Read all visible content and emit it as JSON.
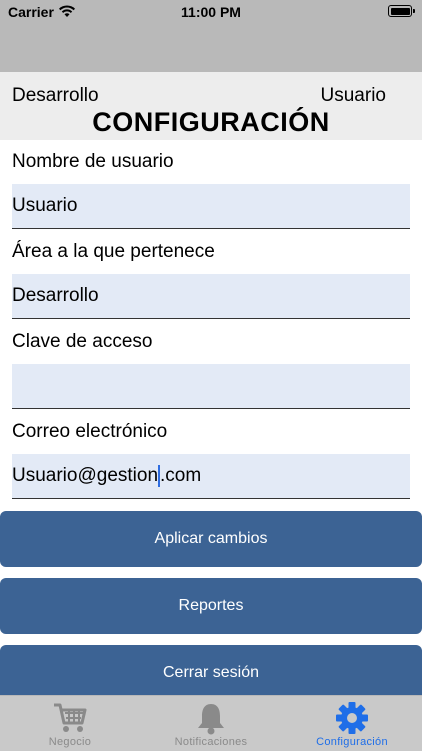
{
  "status_bar": {
    "carrier": "Carrier",
    "time": "11:00 PM"
  },
  "header": {
    "area": "Desarrollo",
    "user": "Usuario",
    "title": "CONFIGURACIÓN"
  },
  "form": {
    "username_label": "Nombre de usuario",
    "username_value": "Usuario",
    "area_label": "Área a la que pertenece",
    "area_value": "Desarrollo",
    "password_label": "Clave de acceso",
    "password_value": "",
    "email_label": "Correo electrónico",
    "email_value_before_caret": "Usuario@gestion",
    "email_value_after_caret": ".com"
  },
  "buttons": {
    "apply": "Aplicar cambios",
    "reports": "Reportes",
    "logout": "Cerrar sesión"
  },
  "tabbar": {
    "items": [
      {
        "label": "Negocio",
        "icon": "cart-icon"
      },
      {
        "label": "Notificaciones",
        "icon": "bell-icon"
      },
      {
        "label": "Configuración",
        "icon": "gear-icon"
      }
    ],
    "active_index": 2,
    "active_color": "#1f6ee8",
    "inactive_color": "#8a8a8a"
  },
  "colors": {
    "button_bg": "#3c6394",
    "field_bg": "#e3eaf6",
    "header_bg": "#ededed",
    "top_bar_bg": "#b9b9b9"
  }
}
